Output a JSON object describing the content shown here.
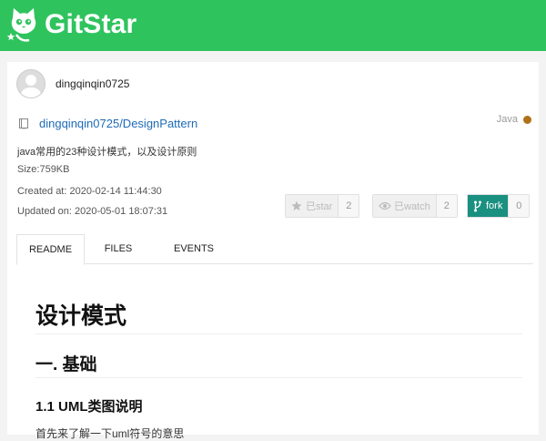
{
  "brand": {
    "name": "GitStar",
    "color": "#2fc35e"
  },
  "user": {
    "name": "dingqinqin0725"
  },
  "repo": {
    "full_name": "dingqinqin0725/DesignPattern",
    "language": "Java",
    "language_color": "#b07219",
    "description": "java常用的23种设计模式，以及设计原则",
    "size": "Size:759KB",
    "created": "Created at: 2020-02-14 11:44:30",
    "updated": "Updated on: 2020-05-01 18:07:31"
  },
  "actions": {
    "star": {
      "label": "已star",
      "count": "2"
    },
    "watch": {
      "label": "已watch",
      "count": "2"
    },
    "fork": {
      "label": "fork",
      "count": "0",
      "color": "#1a9080"
    }
  },
  "tabs": [
    {
      "label": "README"
    },
    {
      "label": "FILES"
    },
    {
      "label": "EVENTS"
    }
  ],
  "readme": {
    "h1": "设计模式",
    "h2": "一. 基础",
    "h3": "1.1 UML类图说明",
    "p": "首先来了解一下uml符号的意思"
  }
}
